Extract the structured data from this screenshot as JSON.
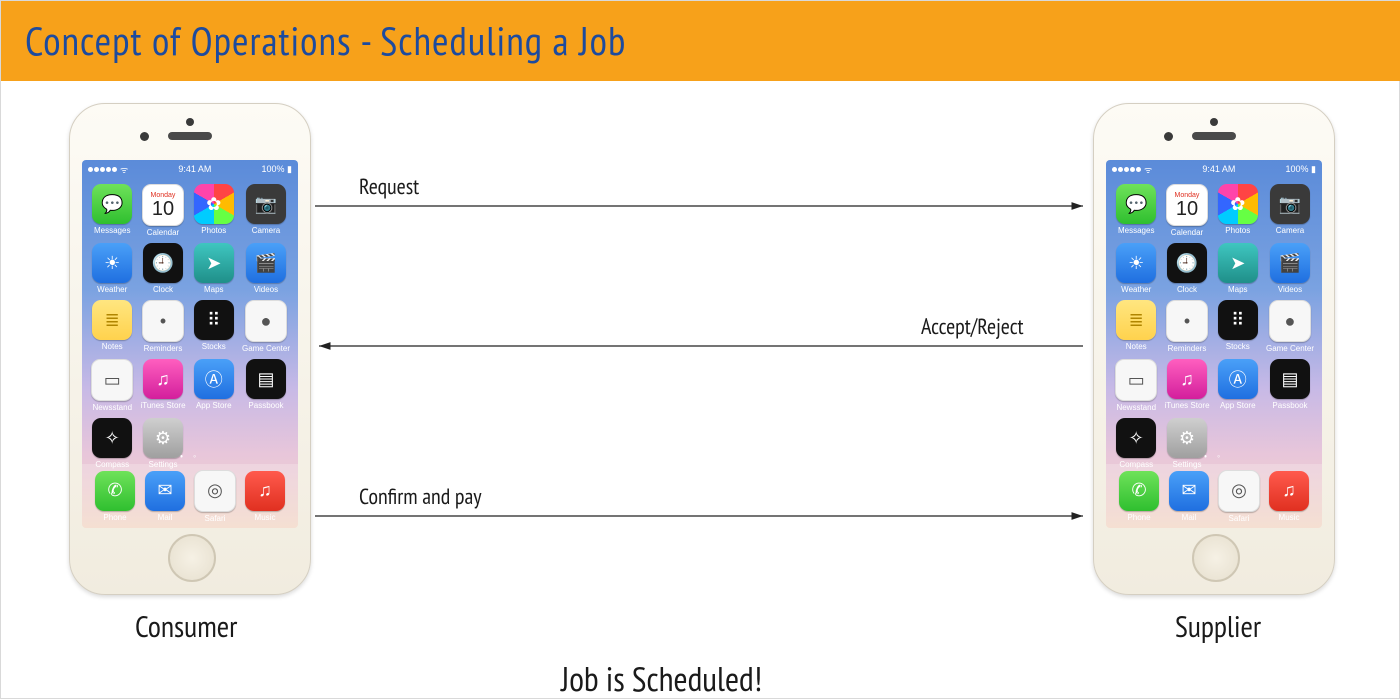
{
  "title": "Concept of Operations - Scheduling a Job",
  "actors": {
    "left": "Consumer",
    "right": "Supplier"
  },
  "arrows": {
    "request": {
      "label": "Request",
      "dir": "right"
    },
    "respond": {
      "label": "Accept/Reject",
      "dir": "left"
    },
    "confirm": {
      "label": "Confirm and pay",
      "dir": "right"
    }
  },
  "result": "Job is Scheduled!",
  "phone_status": {
    "time": "9:41 AM",
    "carrier": "",
    "battery": "100%"
  },
  "calendar": {
    "weekday": "Monday",
    "day": "10"
  },
  "apps_rows": [
    [
      "Messages",
      "Calendar",
      "Photos",
      "Camera"
    ],
    [
      "Weather",
      "Clock",
      "Maps",
      "Videos"
    ],
    [
      "Notes",
      "Reminders",
      "Stocks",
      "Game Center"
    ],
    [
      "Newsstand",
      "iTunes Store",
      "App Store",
      "Passbook"
    ],
    [
      "Compass",
      "Settings",
      "",
      ""
    ]
  ],
  "dock": [
    "Phone",
    "Mail",
    "Safari",
    "Music"
  ],
  "icons": {
    "Messages": "green",
    "Calendar": "cal",
    "Photos": "rainbow",
    "Camera": "dark",
    "Weather": "blue",
    "Clock": "black",
    "Maps": "teal",
    "Videos": "blue",
    "Notes": "yellow",
    "Reminders": "white",
    "Stocks": "black",
    "Game Center": "white",
    "Newsstand": "white",
    "iTunes Store": "pink",
    "App Store": "blue",
    "Passbook": "black",
    "Compass": "black",
    "Settings": "grey",
    "Phone": "green",
    "Mail": "mail",
    "Safari": "white",
    "Music": "red"
  },
  "glyph": {
    "Messages": "💬",
    "Photos": "✿",
    "Camera": "📷",
    "Weather": "☀",
    "Clock": "🕘",
    "Maps": "➤",
    "Videos": "🎬",
    "Notes": "≣",
    "Reminders": "•",
    "Stocks": "⠿",
    "Game Center": "●",
    "Newsstand": "▭",
    "iTunes Store": "♫",
    "App Store": "Ⓐ",
    "Passbook": "▤",
    "Compass": "✧",
    "Settings": "⚙",
    "Phone": "✆",
    "Mail": "✉",
    "Safari": "◎",
    "Music": "♫"
  }
}
